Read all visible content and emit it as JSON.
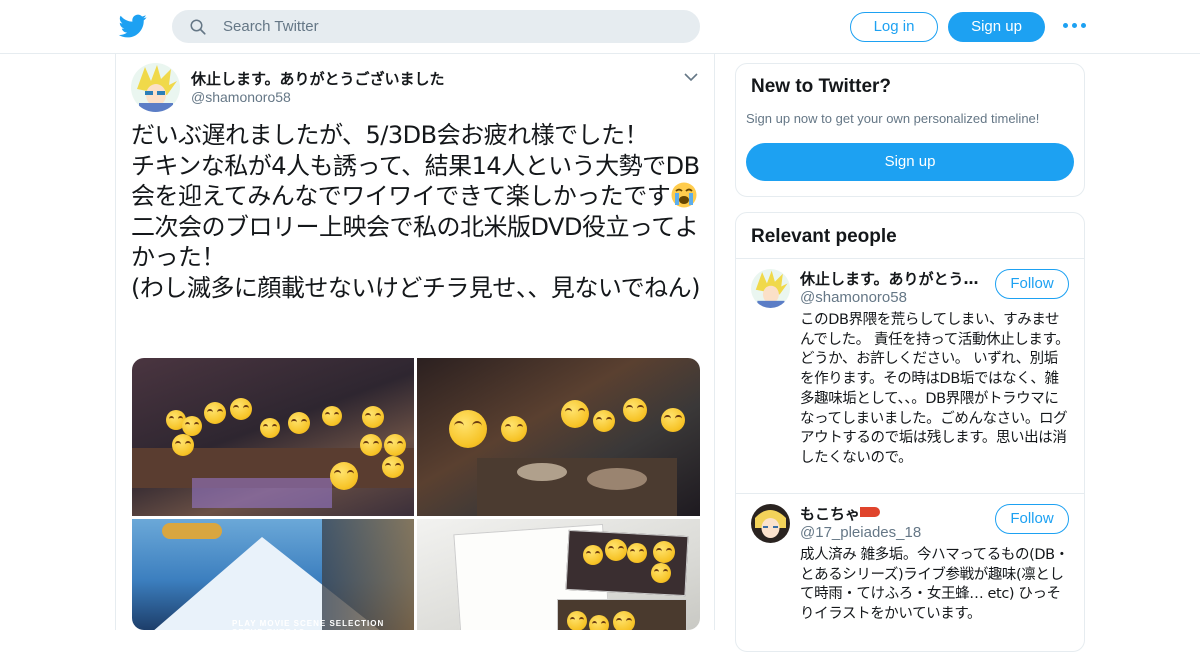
{
  "search": {
    "placeholder": "Search Twitter"
  },
  "nav": {
    "login_label": "Log in",
    "signup_label": "Sign up"
  },
  "tweet": {
    "display_name": "休止します。ありがとうございました",
    "handle": "@shamonoro58",
    "text_part1": "だいぶ遅れましたが、5/3DB会お疲れ様でした！\nチキンな私が4人も誘って、結果14人という大勢でDB会を迎えてみんなでワイワイできて楽しかったです",
    "text_part2": " 二次会のブロリー上映会で私の北米版DVD役立ってよかった！\n(わし滅多に顔載せないけどチラ見せ、、見ないでねん)",
    "media_menu_text": "PLAY MOVIE    SCENE SELECTION    SETUP    EXTRAS"
  },
  "new_card": {
    "title": "New to Twitter?",
    "subtitle": "Sign up now to get your own personalized timeline!",
    "button_label": "Sign up"
  },
  "relevant": {
    "title": "Relevant people",
    "people": [
      {
        "name": "休止します。ありがとう…",
        "handle": "@shamonoro58",
        "follow_label": "Follow",
        "bio": "このDB界隈を荒らしてしまい、すみませんでした。 責任を持って活動休止します。 どうか、お許しください。 いずれ、別垢を作ります。その時はDB垢ではなく、雑多趣味垢として、、。DB界隈がトラウマになってしまいました。ごめんなさい。ログアウトするので垢は残します。思い出は消したくないので。"
      },
      {
        "name": "もこちゃ",
        "handle": "@17_pleiades_18",
        "follow_label": "Follow",
        "bio": "成人済み 雑多垢。今ハマってるもの(DB・とあるシリーズ)ライブ参戦が趣味(凛として時雨・てけふろ・女王蜂… etc) ひっそりイラストをかいています。"
      }
    ]
  },
  "colors": {
    "brand": "#1da1f2",
    "secondary_text": "#657786",
    "border": "#e6ecf0"
  }
}
